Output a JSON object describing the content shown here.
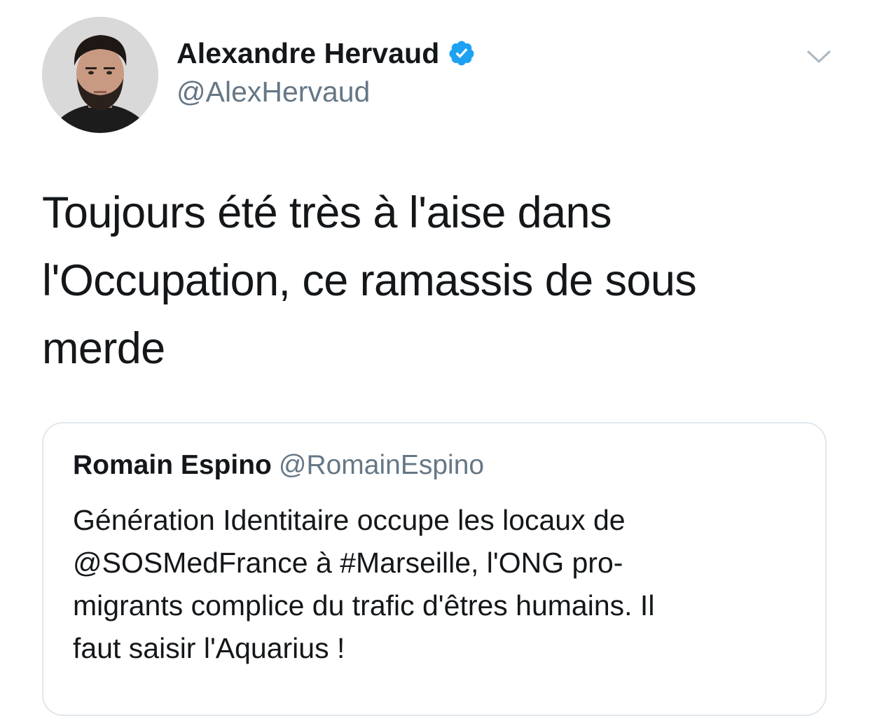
{
  "author": {
    "display_name": "Alexandre Hervaud",
    "handle": "@AlexHervaud",
    "verified": true,
    "avatar_icon": "profile-photo"
  },
  "tweet": {
    "text_lines": [
      "Toujours été très à l'aise dans",
      "l'Occupation, ce ramassis de sous",
      "merde"
    ]
  },
  "quoted_tweet": {
    "display_name": "Romain Espino",
    "handle": "@RomainEspino",
    "text_lines": [
      "Génération Identitaire occupe les locaux de",
      "@SOSMedFrance à #Marseille, l'ONG pro-",
      "migrants complice du trafic d'êtres humains. Il",
      "faut saisir l'Aquarius !"
    ]
  },
  "menu": {
    "icon": "chevron-down-icon"
  },
  "colors": {
    "text_primary": "#14171a",
    "text_secondary": "#657786",
    "verified_blue": "#1da1f2",
    "border": "#e1e8ed"
  }
}
